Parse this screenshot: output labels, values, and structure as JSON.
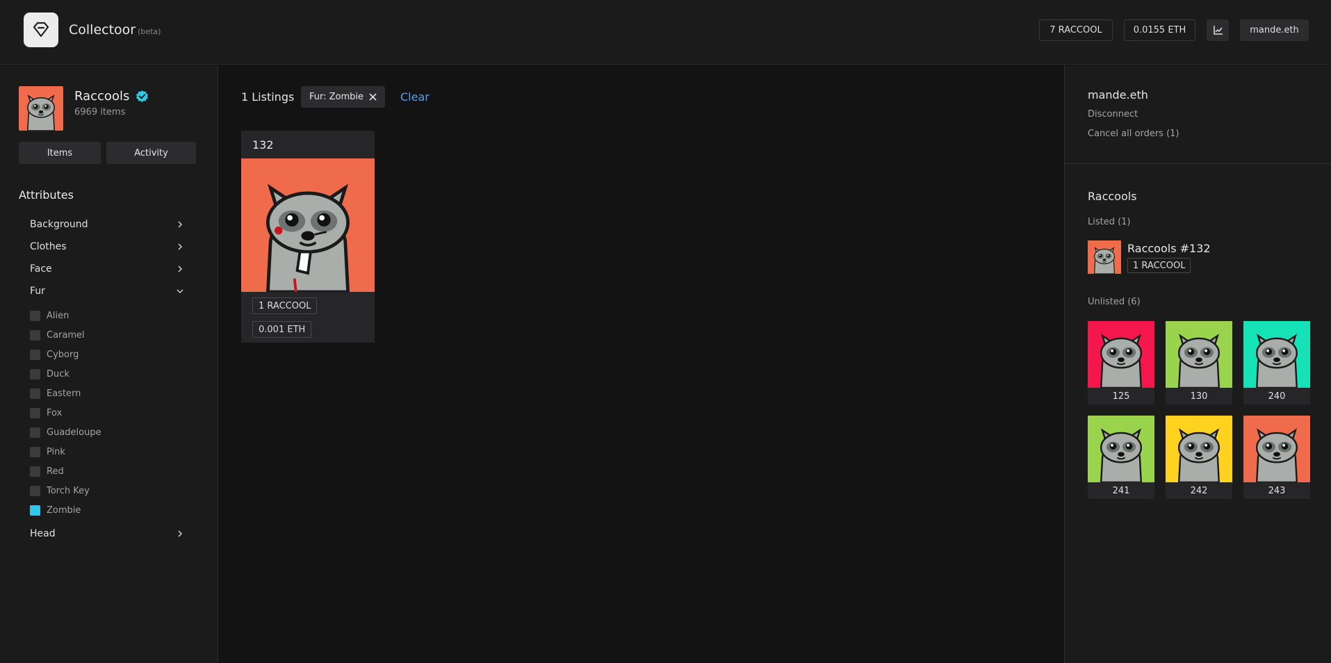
{
  "header": {
    "app_name": "Collectoor",
    "beta_label": "(beta)",
    "token_balance": "7 RACCOOL",
    "eth_balance": "0.0155 ETH",
    "chart_icon": "chart-line-icon",
    "account": "mande.eth"
  },
  "sidebar": {
    "collection_name": "Raccools",
    "item_count": "6969 items",
    "tabs": [
      "Items",
      "Activity"
    ],
    "attributes_heading": "Attributes",
    "attributes": [
      "Background",
      "Clothes",
      "Face",
      "Fur",
      "Head"
    ],
    "fur_options": [
      {
        "label": "Alien",
        "checked": false
      },
      {
        "label": "Caramel",
        "checked": false
      },
      {
        "label": "Cyborg",
        "checked": false
      },
      {
        "label": "Duck",
        "checked": false
      },
      {
        "label": "Eastern",
        "checked": false
      },
      {
        "label": "Fox",
        "checked": false
      },
      {
        "label": "Guadeloupe",
        "checked": false
      },
      {
        "label": "Pink",
        "checked": false
      },
      {
        "label": "Red",
        "checked": false
      },
      {
        "label": "Torch Key",
        "checked": false
      },
      {
        "label": "Zombie",
        "checked": true
      }
    ]
  },
  "main": {
    "listing_count": "1 Listings",
    "filter_chip": "Fur: Zombie",
    "clear_label": "Clear",
    "card": {
      "id": "132",
      "token_price": "1 RACCOOL",
      "eth_price": "0.001 ETH"
    }
  },
  "right_panel": {
    "account": "mande.eth",
    "disconnect_label": "Disconnect",
    "cancel_orders_label": "Cancel all orders (1)",
    "collection_title": "Raccools",
    "listed_label": "Listed (1)",
    "listed_item": {
      "name": "Raccools #132",
      "price": "1 RACCOOL"
    },
    "unlisted_label": "Unlisted (6)",
    "unlisted_items": [
      {
        "id": "125",
        "bg": "#f5164b"
      },
      {
        "id": "130",
        "bg": "#9ad44d"
      },
      {
        "id": "240",
        "bg": "#16e2b8"
      },
      {
        "id": "241",
        "bg": "#9ad44d"
      },
      {
        "id": "242",
        "bg": "#ffd21f"
      },
      {
        "id": "243",
        "bg": "#f06a4c"
      }
    ]
  },
  "colors": {
    "accent_link": "#5a9fea",
    "checked_box": "#2fc9e5",
    "verified_badge": "#2fc9e5",
    "collection_bg": "#f06a4c"
  }
}
